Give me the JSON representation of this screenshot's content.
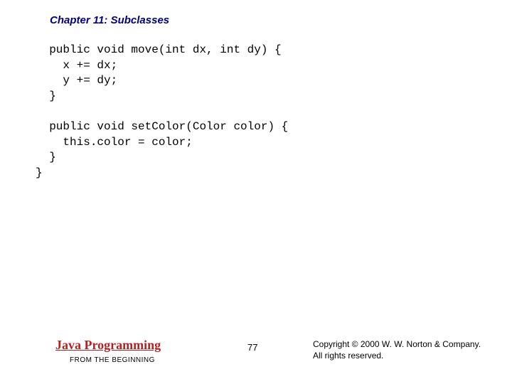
{
  "chapter": {
    "title": "Chapter 11: Subclasses"
  },
  "code": {
    "text": "  public void move(int dx, int dy) {\n    x += dx;\n    y += dy;\n  }\n\n  public void setColor(Color color) {\n    this.color = color;\n  }\n}"
  },
  "footer": {
    "book_title": "Java Programming",
    "book_subtitle": "FROM THE BEGINNING",
    "page_number": "77",
    "copyright_line1": "Copyright © 2000 W. W. Norton & Company.",
    "copyright_line2": "All rights reserved."
  }
}
